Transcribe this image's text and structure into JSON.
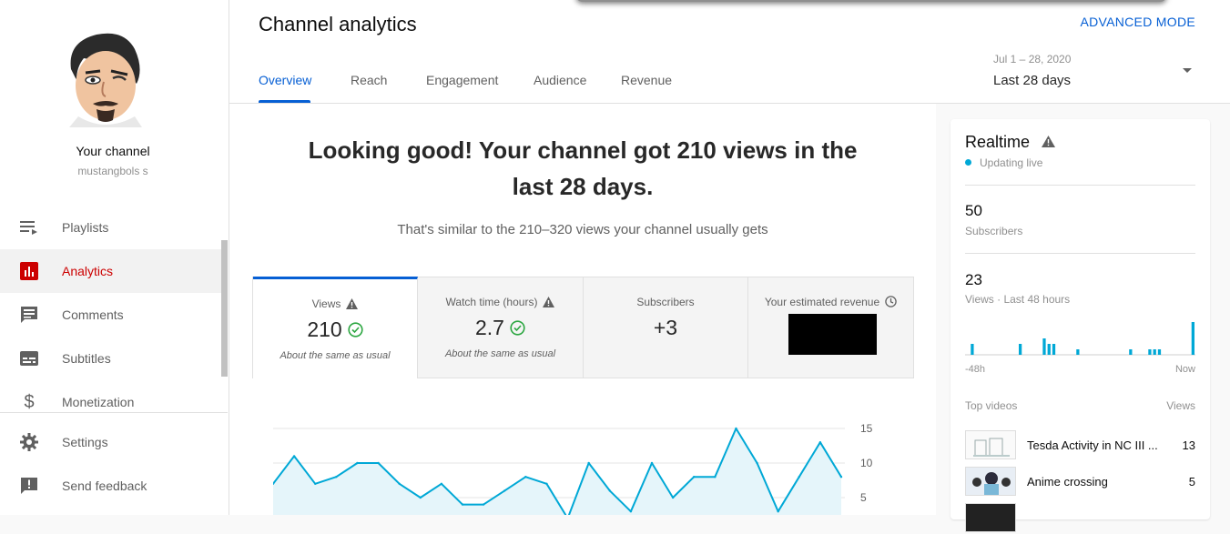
{
  "sidebar": {
    "channel_name": "Your channel",
    "channel_handle": "mustangbols s",
    "items": [
      {
        "label": "Playlists",
        "icon": "playlist-icon"
      },
      {
        "label": "Analytics",
        "icon": "analytics-icon",
        "active": true
      },
      {
        "label": "Comments",
        "icon": "comments-icon"
      },
      {
        "label": "Subtitles",
        "icon": "subtitles-icon"
      },
      {
        "label": "Monetization",
        "icon": "dollar-icon"
      },
      {
        "label": "Settings",
        "icon": "gear-icon"
      },
      {
        "label": "Send feedback",
        "icon": "feedback-icon"
      }
    ]
  },
  "header": {
    "title": "Channel analytics",
    "advanced_mode": "ADVANCED MODE",
    "tabs": [
      "Overview",
      "Reach",
      "Engagement",
      "Audience",
      "Revenue"
    ],
    "date_range": "Jul 1 – 28, 2020",
    "date_label": "Last 28 days"
  },
  "main": {
    "headline": "Looking good! Your channel got 210 views in the last 28 days.",
    "subline": "That's similar to the 210–320 views your channel usually gets",
    "cards": [
      {
        "title": "Views",
        "value": "210",
        "note": "About the same as usual"
      },
      {
        "title": "Watch time (hours)",
        "value": "2.7",
        "note": "About the same as usual"
      },
      {
        "title": "Subscribers",
        "value": "+3",
        "note": ""
      },
      {
        "title": "Your estimated revenue",
        "value": "",
        "note": ""
      }
    ]
  },
  "chart_data": {
    "type": "area",
    "series": [
      {
        "values": [
          7,
          11,
          7,
          8,
          10,
          10,
          7,
          5,
          7,
          4,
          4,
          6,
          8,
          7,
          2,
          10,
          6,
          3,
          10,
          5,
          8,
          8,
          15,
          10,
          3,
          8,
          13,
          8
        ]
      }
    ],
    "ylim": [
      0,
      15
    ],
    "yticks": [
      "15",
      "10",
      "5"
    ],
    "grid": true,
    "color": "#00a8d6"
  },
  "realtime": {
    "title": "Realtime",
    "status": "Updating live",
    "subscribers_value": "50",
    "subscribers_label": "Subscribers",
    "views_value": "23",
    "views_label": "Views · Last 48 hours",
    "axis_start": "-48h",
    "axis_end": "Now",
    "top_videos_label": "Top videos",
    "views_col_label": "Views",
    "hourly_views": [
      0,
      2,
      0,
      0,
      0,
      0,
      0,
      0,
      0,
      0,
      0,
      2,
      0,
      0,
      0,
      0,
      3,
      2,
      2,
      0,
      0,
      0,
      0,
      1,
      0,
      0,
      0,
      0,
      0,
      0,
      0,
      0,
      0,
      0,
      1,
      0,
      0,
      0,
      1,
      1,
      1,
      0,
      0,
      0,
      0,
      0,
      0,
      6
    ],
    "videos": [
      {
        "title": "Tesda Activity in NC III ...",
        "views": "13"
      },
      {
        "title": "Anime crossing",
        "views": "5"
      }
    ]
  }
}
